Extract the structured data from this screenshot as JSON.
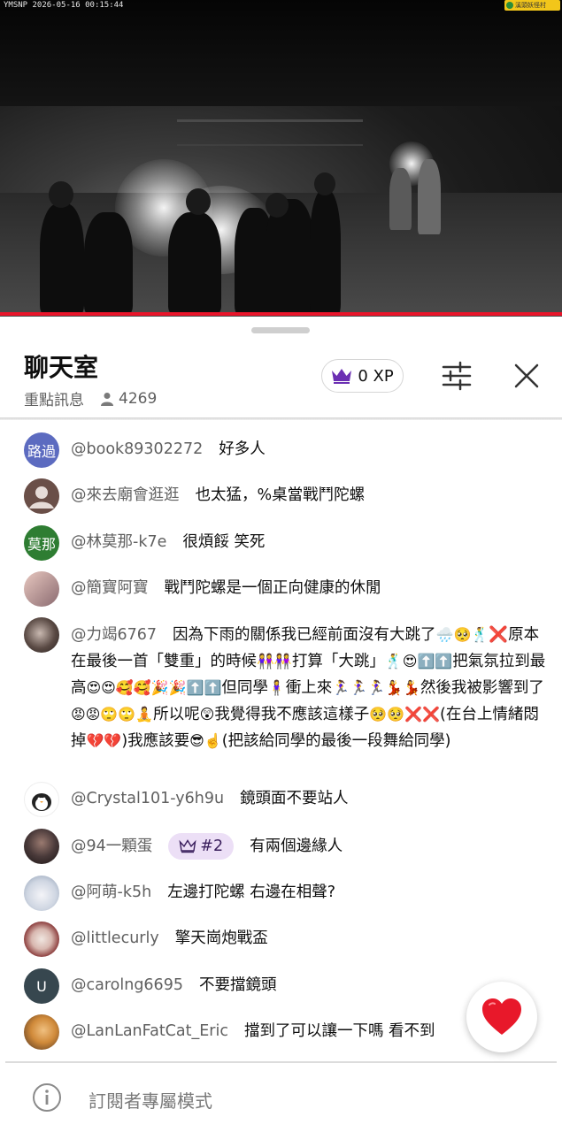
{
  "video": {
    "timestamp": "YMSNP 2026-05-16 00:15:44",
    "brand_badge": "溪頭妖怪村"
  },
  "chat": {
    "title": "聊天室",
    "mode_label": "重點訊息",
    "viewer_count": "4269",
    "xp_label": "0 XP",
    "icons": {
      "crown": "crown-icon",
      "viewers": "person-icon",
      "settings": "tune-icon",
      "close": "close-icon",
      "info": "info-icon",
      "heart": "heart-icon"
    },
    "accent_color": "#e9142a",
    "xp_crown_color": "#6b2fb3"
  },
  "messages": [
    {
      "avatar_text": "路過",
      "avatar_color": "#5c6bc0",
      "author": "@book89302272",
      "text": "好多人"
    },
    {
      "avatar_text": "",
      "avatar_color": "#7a5a50",
      "author": "@來去廟會逛逛",
      "text": "也太猛，%桌當戰鬥陀螺"
    },
    {
      "avatar_text": "莫那",
      "avatar_color": "#2e7d32",
      "author": "@林莫那-k7e",
      "text": "很煩餒 笑死"
    },
    {
      "avatar_text": "",
      "avatar_color": "#c9a7a0",
      "author": "@簡寶阿寶",
      "text": "戰鬥陀螺是一個正向健康的休閒"
    },
    {
      "avatar_text": "",
      "avatar_color": "#5a4a44",
      "author": "@力竭6767",
      "text_parts": [
        "因為下雨的關係我已經前面沒有大跳了",
        "🌧️🥺🕺",
        "❌原本在最後一首「雙重」的時候",
        "👭👭",
        "打算「大跳」",
        "🕺😍",
        "⬆️⬆️",
        "把氣氛拉到最高",
        "😍😍🥰🥰🎉🎉⬆️⬆️",
        "但同學",
        "🧍‍♀️",
        "衝上來",
        "🏃‍♀️🏃‍♀️🏃‍♀️💃💃",
        "然後我被影響到了",
        "😡😡🙄🙄🧘",
        "所以呢",
        "😲",
        "我覺得我不應該這樣子",
        "🥺🥺❌❌",
        "(在台上情緒悶掉",
        "💔💔",
        ")我應該要",
        "😎☝️",
        "(把該給同學的最後一段舞給同學)"
      ]
    },
    {
      "avatar_text": "",
      "avatar_color": "#ffffff",
      "author": "@Crystal101-y6h9u",
      "text": "鏡頭面不要站人"
    },
    {
      "avatar_text": "",
      "avatar_color": "#4a3a3a",
      "author": "@94一顆蛋",
      "badge": "#2",
      "text": "有兩個邊緣人"
    },
    {
      "avatar_text": "",
      "avatar_color": "#d8dde6",
      "author": "@阿萌-k5h",
      "text": "左邊打陀螺 右邊在相聲?"
    },
    {
      "avatar_text": "",
      "avatar_color": "#8a3a3a",
      "author": "@littlecurly",
      "text": "擎天崗炮戰盃"
    },
    {
      "avatar_text": "U",
      "avatar_color": "#37474f",
      "author": "@carolng6695",
      "text": "不要擋鏡頭"
    },
    {
      "avatar_text": "",
      "avatar_color": "#d08a3a",
      "author": "@LanLanFatCat_Eric",
      "text": "擋到了可以讓一下嗎 看不到"
    }
  ],
  "footer": {
    "text": "訂閱者專屬模式"
  }
}
